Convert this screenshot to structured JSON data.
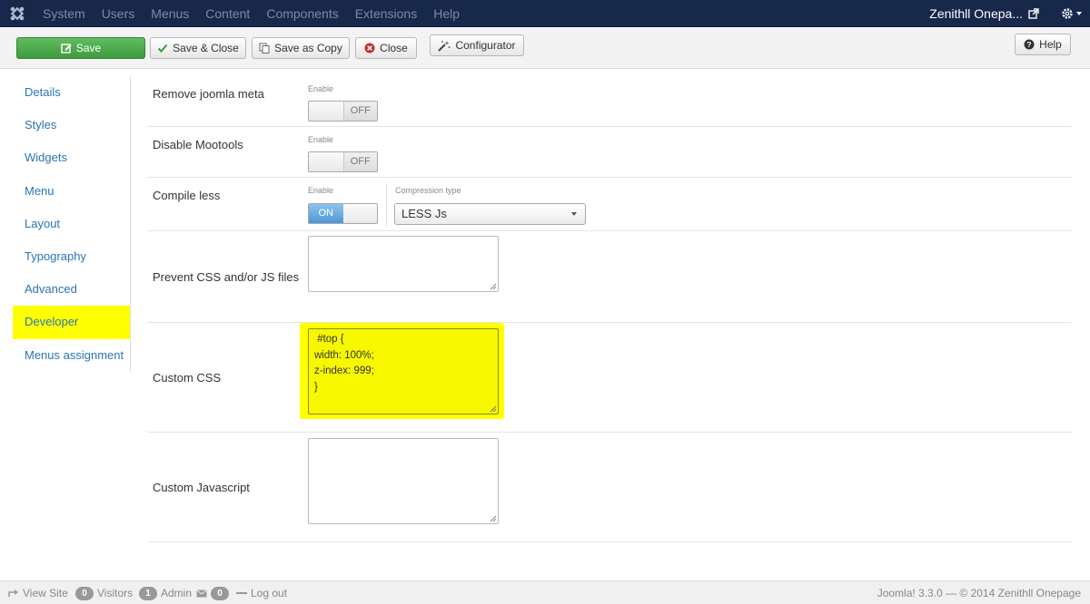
{
  "navbar": {
    "menu": [
      "System",
      "Users",
      "Menus",
      "Content",
      "Components",
      "Extensions",
      "Help"
    ],
    "site_name": "Zenithll Onepa..."
  },
  "toolbar": {
    "save": "Save",
    "save_close": "Save & Close",
    "save_copy": "Save as Copy",
    "close": "Close",
    "configurator": "Configurator",
    "help": "Help"
  },
  "sidebar": {
    "items": [
      "Details",
      "Styles",
      "Widgets",
      "Menu",
      "Layout",
      "Typography",
      "Advanced",
      "Developer",
      "Menus assignment"
    ],
    "active": "Developer"
  },
  "form": {
    "remove_meta": {
      "label": "Remove joomla meta",
      "caption": "Enable",
      "state": "OFF"
    },
    "disable_mootools": {
      "label": "Disable Mootools",
      "caption": "Enable",
      "state": "OFF"
    },
    "compile_less": {
      "label": "Compile less",
      "caption": "Enable",
      "state": "ON",
      "compression_caption": "Compression type",
      "compression_value": "LESS Js"
    },
    "prevent_files": {
      "label": "Prevent CSS and/or JS files",
      "value": ""
    },
    "custom_css": {
      "label": "Custom CSS",
      "lines": [
        " #top {",
        "width: 100%;",
        "z-index: 999;",
        "}"
      ]
    },
    "custom_js": {
      "label": "Custom Javascript",
      "value": ""
    }
  },
  "footer": {
    "view_site": "View Site",
    "visitors_count": "0",
    "visitors": "Visitors",
    "admin_count": "1",
    "admin": "Admin",
    "messages_count": "0",
    "logout": "Log out",
    "version": "Joomla! 3.3.0 — © 2014 Zenithll Onepage"
  },
  "colors": {
    "navbar_bg": "#17284a",
    "save_green": "#46a546",
    "link_blue": "#2a75b5",
    "highlight": "#ffff00"
  }
}
